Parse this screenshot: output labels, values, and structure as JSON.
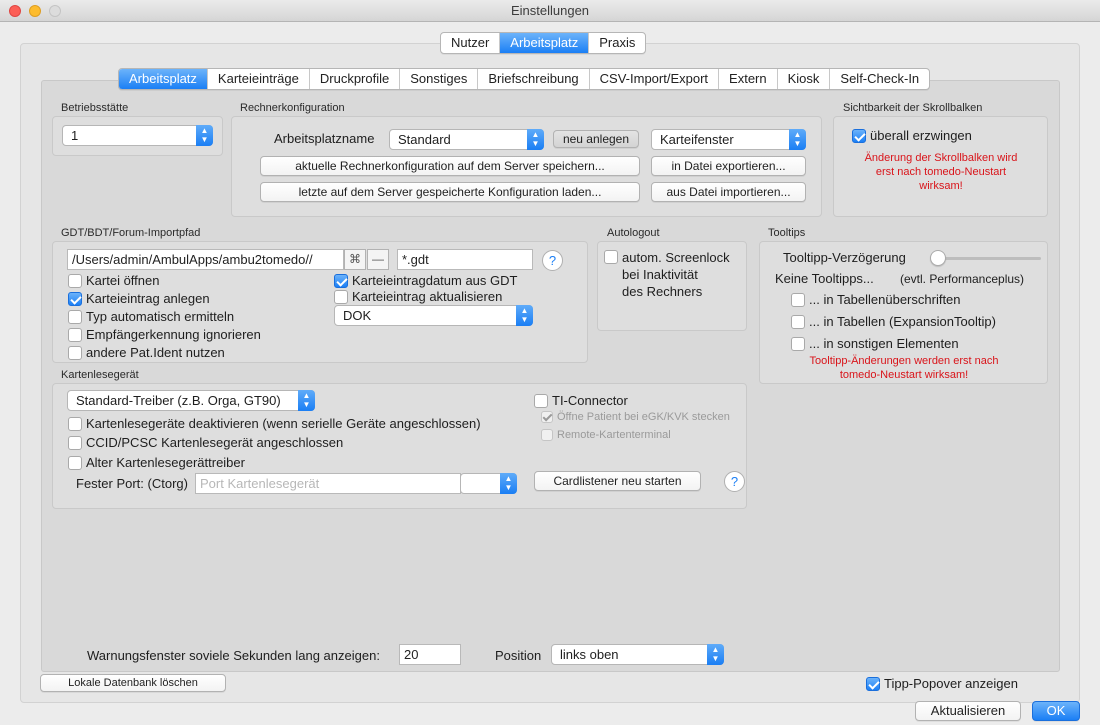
{
  "window": {
    "title": "Einstellungen"
  },
  "top_tabs": [
    "Nutzer",
    "Arbeitsplatz",
    "Praxis"
  ],
  "top_tabs_active": "Arbeitsplatz",
  "sub_tabs": [
    "Arbeitsplatz",
    "Karteieinträge",
    "Druckprofile",
    "Sonstiges",
    "Briefschreibung",
    "CSV-Import/Export",
    "Extern",
    "Kiosk",
    "Self-Check-In"
  ],
  "sub_tabs_active": "Arbeitsplatz",
  "betriebsstaette": {
    "label": "Betriebsstätte",
    "value": "1"
  },
  "rechner": {
    "label": "Rechnerkonfiguration",
    "name_label": "Arbeitsplatzname",
    "name_value": "Standard",
    "new_button": "neu anlegen",
    "window_select": "Karteifenster",
    "save_server": "aktuelle Rechnerkonfiguration auf dem Server speichern...",
    "load_server": "letzte auf dem Server gespeicherte Konfiguration laden...",
    "export_file": "in Datei exportieren...",
    "import_file": "aus Datei importieren..."
  },
  "scroll": {
    "label": "Sichtbarkeit der Skrollbalken",
    "force_label": "überall erzwingen",
    "force_checked": true,
    "note_line1": "Änderung der Skrollbalken wird",
    "note_line2": "erst nach tomedo-Neustart",
    "note_line3": "wirksam!"
  },
  "gdt": {
    "label": "GDT/BDT/Forum-Importpfad",
    "path": "/Users/admin/AmbulApps/ambu2tomedo//",
    "remove_label": "—",
    "pattern": "*.gdt",
    "help": "?",
    "options_left": [
      {
        "label": "Kartei öffnen",
        "checked": false
      },
      {
        "label": "Karteieintrag anlegen",
        "checked": true
      },
      {
        "label": "Typ automatisch ermitteln",
        "checked": false
      },
      {
        "label": "Empfängerkennung ignorieren",
        "checked": false
      },
      {
        "label": "andere Pat.Ident nutzen",
        "checked": false
      }
    ],
    "options_right": [
      {
        "label": "Karteieintragdatum aus GDT",
        "checked": true
      },
      {
        "label": "Karteieintrag aktualisieren",
        "checked": false
      }
    ],
    "type_select": "DOK"
  },
  "autologout": {
    "label": "Autologout",
    "line1": "autom. Screenlock",
    "line2": "bei Inaktivität",
    "line3": "des Rechners",
    "checked": false
  },
  "tooltips": {
    "label": "Tooltips",
    "delay_label": "Tooltipp-Verzögerung",
    "delay_value": 0,
    "none_label": "Keine Tooltipps...",
    "perf_label": "(evtl. Performanceplus)",
    "options": [
      {
        "label": "... in Tabellenüberschriften",
        "checked": false
      },
      {
        "label": "... in Tabellen (ExpansionTooltip)",
        "checked": false
      },
      {
        "label": "... in sonstigen Elementen",
        "checked": false
      }
    ],
    "note_line1": "Tooltipp-Änderungen werden erst nach",
    "note_line2": "tomedo-Neustart wirksam!"
  },
  "card": {
    "label": "Kartenlesegerät",
    "driver_select": "Standard-Treiber (z.B. Orga, GT90)",
    "options": [
      {
        "label": "Kartenlesegeräte deaktivieren (wenn serielle Geräte angeschlossen)",
        "checked": false
      },
      {
        "label": "CCID/PCSC Kartenlesegerät angeschlossen",
        "checked": false
      },
      {
        "label": "Alter Kartenlesegerättreiber",
        "checked": false
      }
    ],
    "port_label": "Fester Port: (Ctorg)",
    "port_placeholder": "Port Kartenlesegerät",
    "ti_label": "TI-Connector",
    "ti_checked": false,
    "open_patient": "Öffne Patient bei eGK/KVK stecken",
    "open_patient_checked": true,
    "remote_terminal": "Remote-Kartenterminal",
    "remote_checked": false,
    "restart_button": "Cardlistener neu starten",
    "help": "?"
  },
  "warning": {
    "label": "Warnungsfenster soviele Sekunden lang anzeigen:",
    "seconds": "20",
    "position_label": "Position",
    "position_value": "links oben"
  },
  "footer": {
    "delete_db": "Lokale Datenbank löschen",
    "tipp_popover": "Tipp-Popover anzeigen",
    "tipp_checked": true,
    "update_button": "Aktualisieren",
    "ok_button": "OK"
  },
  "colors": {
    "accent": "#1b7ff5",
    "warning_text": "#d9141a"
  }
}
